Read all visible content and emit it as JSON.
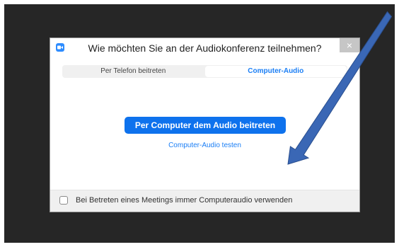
{
  "dialog": {
    "title": "Wie möchten Sie an der Audiokonferenz teilnehmen?",
    "close_label": "×"
  },
  "tabs": [
    {
      "label": "Per Telefon beitreten",
      "active": false
    },
    {
      "label": "Computer-Audio",
      "active": true
    }
  ],
  "main": {
    "join_button_label": "Per Computer dem Audio beitreten",
    "test_link_label": "Computer-Audio testen"
  },
  "footer": {
    "checkbox_checked": false,
    "checkbox_label": "Bei Betreten eines Meetings immer Computeraudio verwenden"
  },
  "colors": {
    "accent": "#0e72ed",
    "link": "#1a7ef5",
    "backdrop": "#262626",
    "arrow": "#3a67b5"
  },
  "icons": {
    "app": "zoom-camera-icon",
    "close": "close-icon",
    "annotation": "arrow-annotation"
  }
}
